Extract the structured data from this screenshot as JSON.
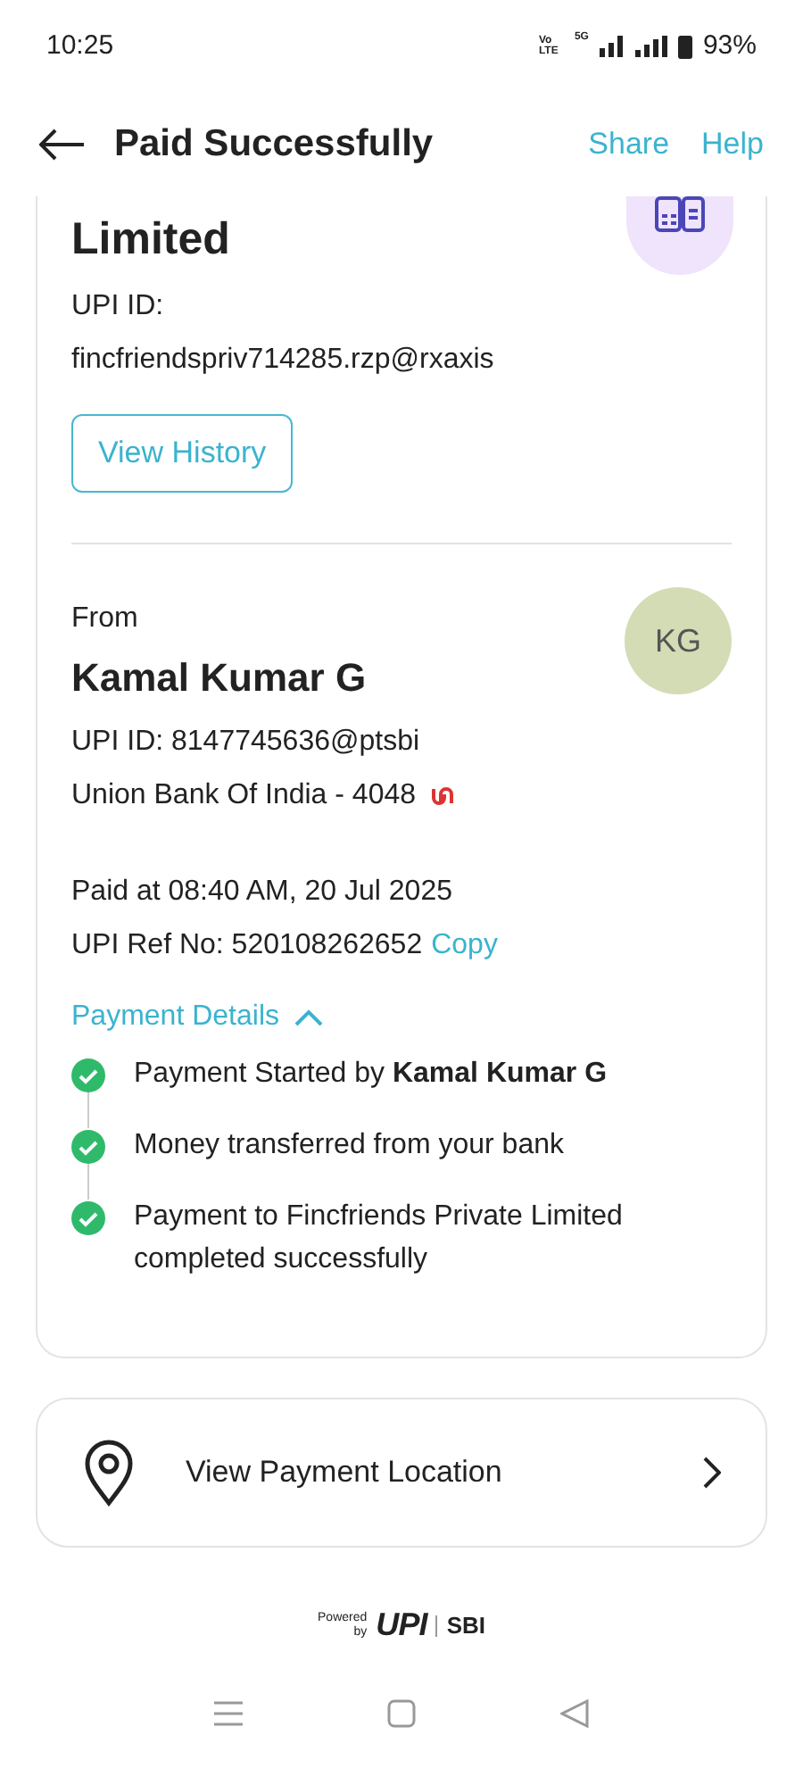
{
  "status_bar": {
    "time": "10:25",
    "volte": "Vo LTE",
    "network": "5G",
    "battery": "93%"
  },
  "header": {
    "title": "Paid Successfully",
    "actions": [
      "Share",
      "Help"
    ]
  },
  "payee": {
    "name": "Limited",
    "upi_label": "UPI ID:",
    "upi_id": "fincfriendspriv714285.rzp@rxaxis",
    "button": "View History"
  },
  "payer": {
    "label": "From",
    "name": "Kamal Kumar G",
    "initials": "KG",
    "upi_id": "UPI ID: 8147745636@ptsbi",
    "bank": "Union Bank Of India - 4048"
  },
  "paid_at": "Paid at 08:40 AM, 20 Jul 2025",
  "ref_label": "UPI Ref No: 520108262652",
  "copy": "Copy",
  "details": {
    "title": "Payment Details",
    "expanded": true,
    "steps": [
      {
        "text": "Payment Started by **Kamal Kumar G**",
        "done": true
      },
      {
        "text": "Money transferred from your bank",
        "done": true
      },
      {
        "text": "Payment to Fincfriends Private Limited completed successfully",
        "done": true
      }
    ]
  },
  "location": {
    "label": "View Payment Location"
  },
  "footer": {
    "powered": "Powered",
    "by": "by",
    "upi": "UPI",
    "bank": "SBI"
  }
}
